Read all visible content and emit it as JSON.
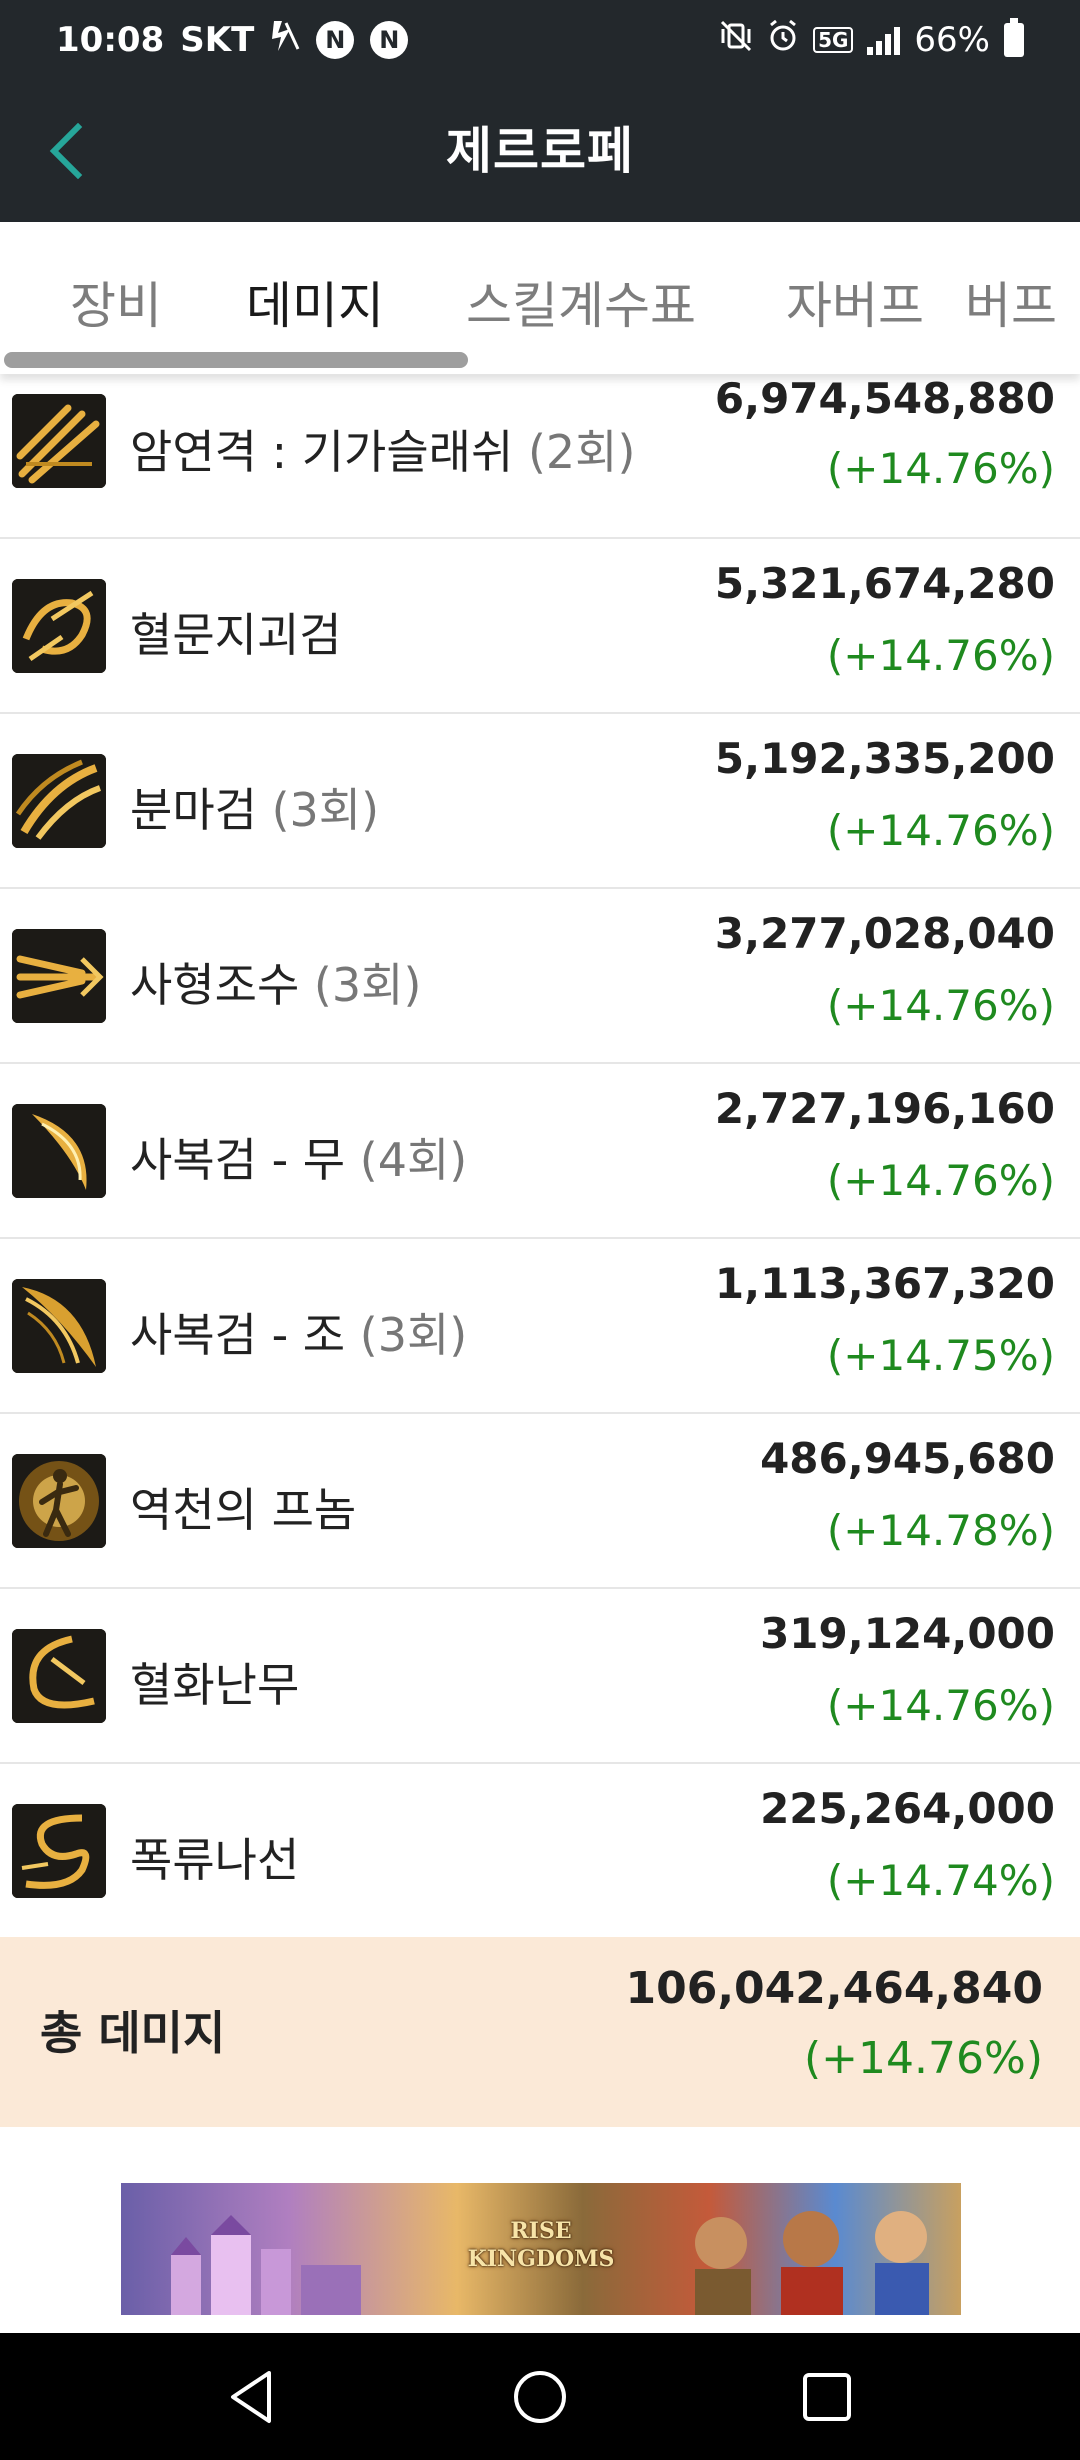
{
  "status_bar": {
    "time": "10:08",
    "carrier": "SKT",
    "notif_icons": [
      "N",
      "N"
    ],
    "network": "5G",
    "battery": "66%"
  },
  "app_bar": {
    "title": "제르로페",
    "back_icon": "chevron-left-icon"
  },
  "tabs": [
    {
      "label": "장비",
      "active": false
    },
    {
      "label": "데미지",
      "active": true
    },
    {
      "label": "스킬계수표",
      "active": false
    },
    {
      "label": "자버프",
      "active": false
    },
    {
      "label": "버프",
      "active": false
    }
  ],
  "skills": [
    {
      "name": "암연격 : 기가슬래쉬",
      "count": "(2회)",
      "damage": "6,974,548,880",
      "change": "(+14.76%)",
      "icon": "triple-slash-icon"
    },
    {
      "name": "혈문지괴검",
      "count": "",
      "damage": "5,321,674,280",
      "change": "(+14.76%)",
      "icon": "swirl-blade-icon"
    },
    {
      "name": "분마검",
      "count": "(3회)",
      "damage": "5,192,335,200",
      "change": "(+14.76%)",
      "icon": "double-slash-icon"
    },
    {
      "name": "사형조수",
      "count": "(3회)",
      "damage": "3,277,028,040",
      "change": "(+14.76%)",
      "icon": "claw-strike-icon"
    },
    {
      "name": "사복검 - 무",
      "count": "(4회)",
      "damage": "2,727,196,160",
      "change": "(+14.76%)",
      "icon": "crescent-slash-icon"
    },
    {
      "name": "사복검 - 조",
      "count": "(3회)",
      "damage": "1,113,367,320",
      "change": "(+14.75%)",
      "icon": "wing-slash-icon"
    },
    {
      "name": "역천의 프놈",
      "count": "",
      "damage": "486,945,680",
      "change": "(+14.78%)",
      "icon": "figure-glow-icon"
    },
    {
      "name": "혈화난무",
      "count": "",
      "damage": "319,124,000",
      "change": "(+14.76%)",
      "icon": "whirl-slash-icon"
    },
    {
      "name": "폭류나선",
      "count": "",
      "damage": "225,264,000",
      "change": "(+14.74%)",
      "icon": "spiral-icon"
    }
  ],
  "total": {
    "label": "총 데미지",
    "damage": "106,042,464,840",
    "change": "(+14.76%)"
  },
  "ad": {
    "logo_text": "RISE KINGDOMS"
  },
  "colors": {
    "bar_bg": "#23282c",
    "accent": "#26a69a",
    "positive": "#1f8a1f",
    "total_bg": "#fbe9d7"
  }
}
